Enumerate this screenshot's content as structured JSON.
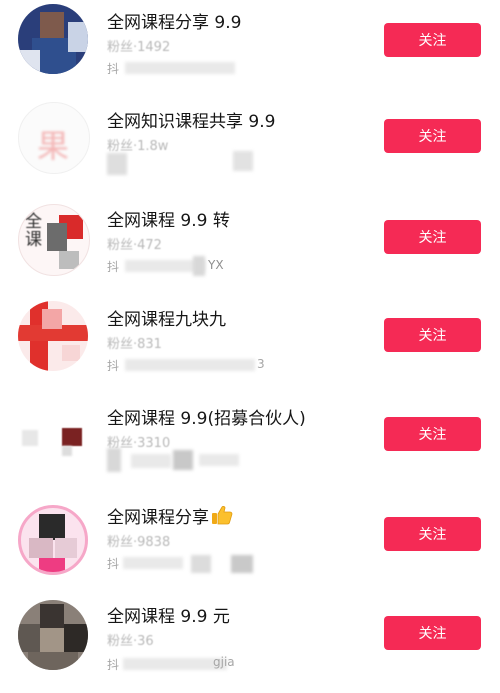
{
  "follow_label": "关注",
  "accent": "#f52a55",
  "items": [
    {
      "title": "全网课程分享 9.9",
      "fans": "粉丝·1492",
      "handle": "抖"
    },
    {
      "title": "全网知识课程共享 9.9",
      "fans": "粉丝·1.8w",
      "handle": "",
      "avatar_text": "果"
    },
    {
      "title": "全网课程 9.9 转",
      "fans": "粉丝·472",
      "handle": "抖",
      "handle_tail": "YX",
      "avatar_text": "全课"
    },
    {
      "title": "全网课程九块九",
      "fans": "粉丝·831",
      "handle": "抖",
      "handle_tail": "3"
    },
    {
      "title": "全网课程 9.9(招募合伙人)",
      "fans": "粉丝·3310",
      "handle": ""
    },
    {
      "title": "全网课程分享",
      "title_icon": "thumbs-up-icon",
      "fans": "粉丝·9838",
      "handle": "抖"
    },
    {
      "title": "全网课程 9.9 元",
      "fans": "粉丝·36",
      "handle": "抖",
      "handle_tail": "gjia"
    }
  ]
}
